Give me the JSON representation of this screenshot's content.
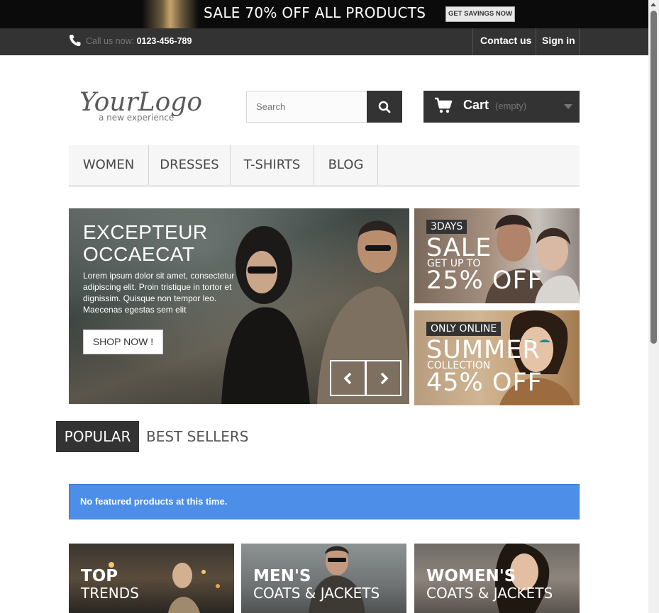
{
  "promo": {
    "text": "SALE 70% OFF ALL PRODUCTS",
    "button": "GET SAVINGS NOW"
  },
  "topbar": {
    "call_label": "Call us now:",
    "phone": "0123-456-789",
    "contact": "Contact us",
    "signin": "Sign in"
  },
  "logo": {
    "main": "YourLogo",
    "tagline": "a new experience"
  },
  "search": {
    "placeholder": "Search"
  },
  "cart": {
    "label": "Cart",
    "status": "(empty)"
  },
  "menu": {
    "items": [
      "WOMEN",
      "DRESSES",
      "T-SHIRTS",
      "BLOG"
    ]
  },
  "slider": {
    "title_line1": "EXCEPTEUR",
    "title_line2": "OCCAECAT",
    "description": "Lorem ipsum dolor sit amet, consectetur adipiscing elit. Proin tristique in tortor et dignissim. Quisque non tempor leo. Maecenas egestas sem elit",
    "button": "SHOP NOW !"
  },
  "banners": [
    {
      "tag": "3DAYS",
      "big": "SALE",
      "small": "GET UP TO",
      "offer": "25% OFF"
    },
    {
      "tag": "ONLY ONLINE",
      "big": "SUMMER",
      "small": "COLLECTION",
      "offer": "45% OFF"
    }
  ],
  "tabs": {
    "popular": "POPULAR",
    "best_sellers": "BEST SELLERS"
  },
  "alert": {
    "text": "No featured products at this time."
  },
  "cards": [
    {
      "line1": "TOP",
      "line2": "TRENDS"
    },
    {
      "line1": "MEN'S",
      "line2": "COATS & JACKETS"
    },
    {
      "line1": "WOMEN'S",
      "line2": "COATS & JACKETS"
    }
  ],
  "colors": {
    "dark": "#333333",
    "alert": "#4c8ee8",
    "menu_bg": "#f6f6f6"
  }
}
